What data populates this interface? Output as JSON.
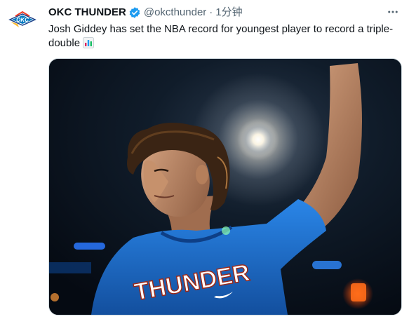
{
  "tweet": {
    "author_name": "OKC THUNDER",
    "handle": "@okcthunder",
    "separator": "·",
    "time": "1分钟",
    "text": "Josh Giddey has set the NBA record for youngest player to record a triple-double",
    "emoji": "bar-chart-icon",
    "verified": true,
    "more_icon": "more-options-icon"
  },
  "media": {
    "jersey_text": "THUNDER",
    "alt": ""
  },
  "colors": {
    "verified_blue": "#1d9bf0",
    "muted_text": "#536471",
    "jersey_blue": "#1f72d6",
    "okc_orange": "#ef3b24",
    "okc_blue": "#007ac1"
  }
}
